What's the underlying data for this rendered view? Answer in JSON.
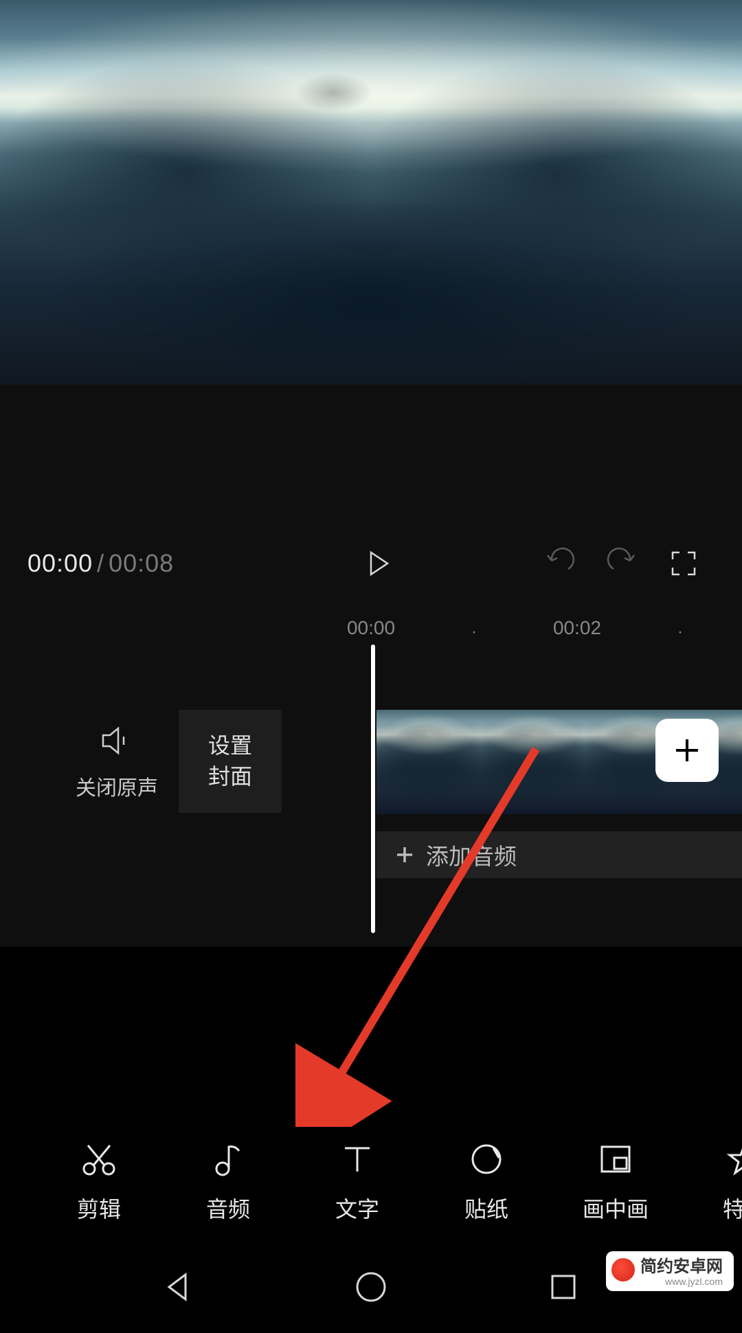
{
  "playback": {
    "current_time": "00:00",
    "separator": "/",
    "total_time": "00:08"
  },
  "ruler": {
    "mark_0": "00:00",
    "mark_2": "00:02"
  },
  "timeline": {
    "mute_label": "关闭原声",
    "cover_line1": "设置",
    "cover_line2": "封面",
    "add_audio": "添加音频"
  },
  "toolbar": [
    {
      "key": "edit",
      "label": "剪辑"
    },
    {
      "key": "audio",
      "label": "音频"
    },
    {
      "key": "text",
      "label": "文字"
    },
    {
      "key": "sticker",
      "label": "贴纸"
    },
    {
      "key": "pip",
      "label": "画中画"
    },
    {
      "key": "effect",
      "label": "特效"
    }
  ],
  "watermark": {
    "title": "简约安卓网",
    "url": "www.jyzl.com"
  }
}
